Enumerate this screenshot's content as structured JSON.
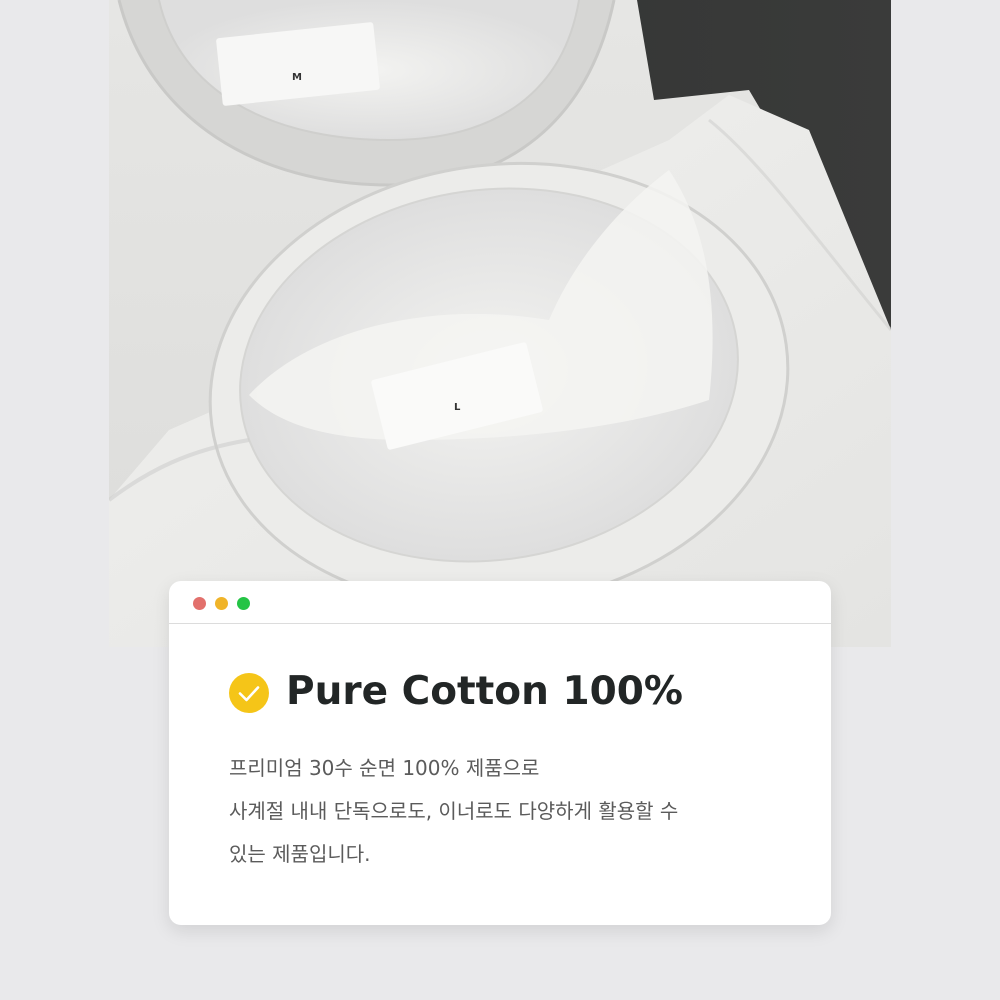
{
  "photo": {
    "label_size_back": "M",
    "label_size_front": "L"
  },
  "window": {
    "controls": [
      "close",
      "minimize",
      "maximize"
    ],
    "colors": {
      "close": "#e2706c",
      "minimize": "#f0b429",
      "maximize": "#24c445"
    }
  },
  "content": {
    "icon": "check-circle-icon",
    "accent": "#f5c518",
    "title": "Pure Cotton 100%",
    "description_lines": [
      "프리미엄 30수 순면 100% 제품으로",
      "사계절 내내 단독으로도, 이너로도 다양하게 활용할 수",
      "있는 제품입니다."
    ]
  }
}
